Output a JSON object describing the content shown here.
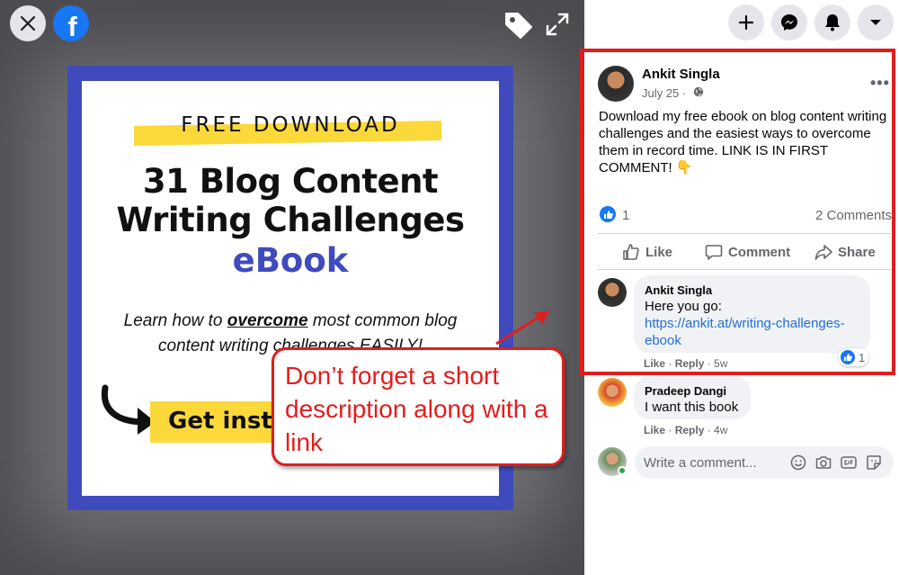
{
  "viewer": {
    "close_icon": "close-icon",
    "brand_letter": "f",
    "ebook": {
      "kicker": "FREE DOWNLOAD",
      "title_line1": "31 Blog Content",
      "title_line2": "Writing Challenges",
      "subtitle": "eBook",
      "desc_prefix": "Learn how to ",
      "desc_emph": "overcome",
      "desc_suffix": " most common blog content writing challenges EASILY!",
      "cta": "Get instant"
    },
    "callout": "Don’t forget a short description along with a link"
  },
  "post": {
    "author": "Ankit Singla",
    "date": "July 25 ·",
    "text": "Download my free ebook on blog content writing challenges and the easiest ways to overcome them in record time. LINK IS IN FIRST COMMENT! 👇",
    "likes": "1",
    "comments": "2 Comments",
    "actions": {
      "like": "Like",
      "comment": "Comment",
      "share": "Share"
    }
  },
  "comments": [
    {
      "name": "Ankit Singla",
      "text": "Here you go:",
      "link": "https://ankit.at/writing-challenges-ebook",
      "like": "Like",
      "reply": "Reply",
      "age": "5w",
      "reactions": "1"
    },
    {
      "name": "Pradeep Dangi",
      "text": "I want this book",
      "like": "Like",
      "reply": "Reply",
      "age": "4w"
    }
  ],
  "composer": {
    "placeholder": "Write a comment..."
  },
  "colors": {
    "facebook_blue": "#1877f2",
    "annotation_red": "#e21d1d",
    "ebook_blue": "#3f4bbd",
    "highlight_yellow": "#fcd93a"
  }
}
